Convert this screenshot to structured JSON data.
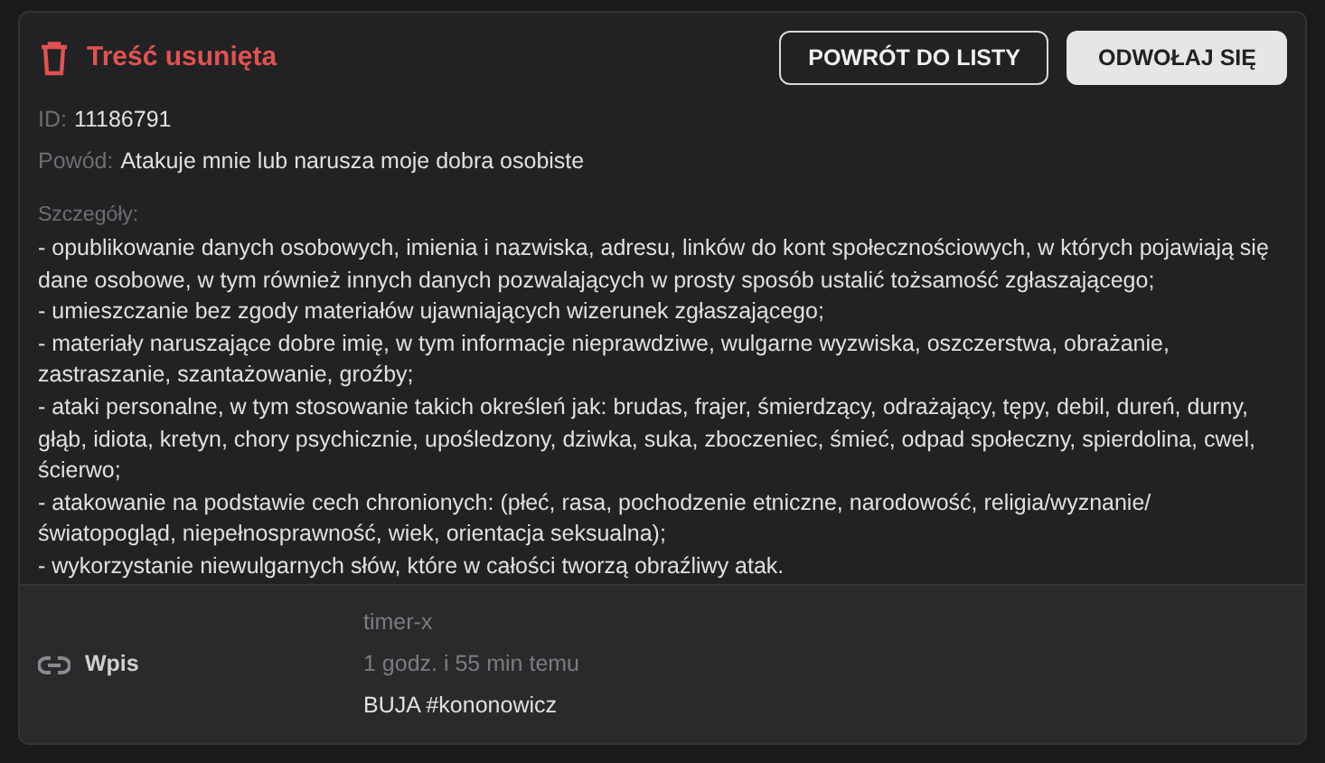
{
  "header": {
    "title": "Treść usunięta",
    "buttons": [
      {
        "label": "POWRÓT DO LISTY",
        "kind": "outline"
      },
      {
        "label": "ODWOŁAJ SIĘ",
        "kind": "filled"
      }
    ]
  },
  "fields": [
    {
      "label": "ID:",
      "value": "11186791"
    },
    {
      "label": "Powód:",
      "value": "Atakuje mnie lub narusza moje dobra osobiste"
    }
  ],
  "details": {
    "label": "Szczegóły:",
    "lines": [
      "- opublikowanie danych osobowych, imienia i nazwiska, adresu, linków do kont społecznościowych, w których pojawiają się dane osobowe, w tym również innych danych pozwalających w prosty sposób ustalić tożsamość zgłaszającego;",
      "- umieszczanie bez zgody materiałów ujawniających wizerunek zgłaszającego;",
      "- materiały naruszające dobre imię, w tym informacje nieprawdziwe, wulgarne wyzwiska, oszczerstwa, obrażanie, zastraszanie, szantażowanie, groźby;",
      "- ataki personalne, w tym stosowanie takich określeń jak: brudas, frajer, śmierdzący, odrażający, tępy, debil, dureń, durny, głąb, idiota, kretyn, chory psychicznie, upośledzony, dziwka, suka, zboczeniec, śmieć, odpad społeczny, spierdolina, cwel, ścierwo;",
      "- atakowanie na podstawie cech chronionych: (płeć, rasa, pochodzenie etniczne, narodowość, religia/wyznanie/światopogląd, niepełnosprawność, wiek, orientacja seksualna);",
      "- wykorzystanie niewulgarnych słów, które w całości tworzą obraźliwy atak."
    ]
  },
  "entry": {
    "label": "Wpis",
    "author": "timer-x",
    "time": "1 godz. i 55 min temu",
    "content": "BUJA #kononowicz"
  }
}
